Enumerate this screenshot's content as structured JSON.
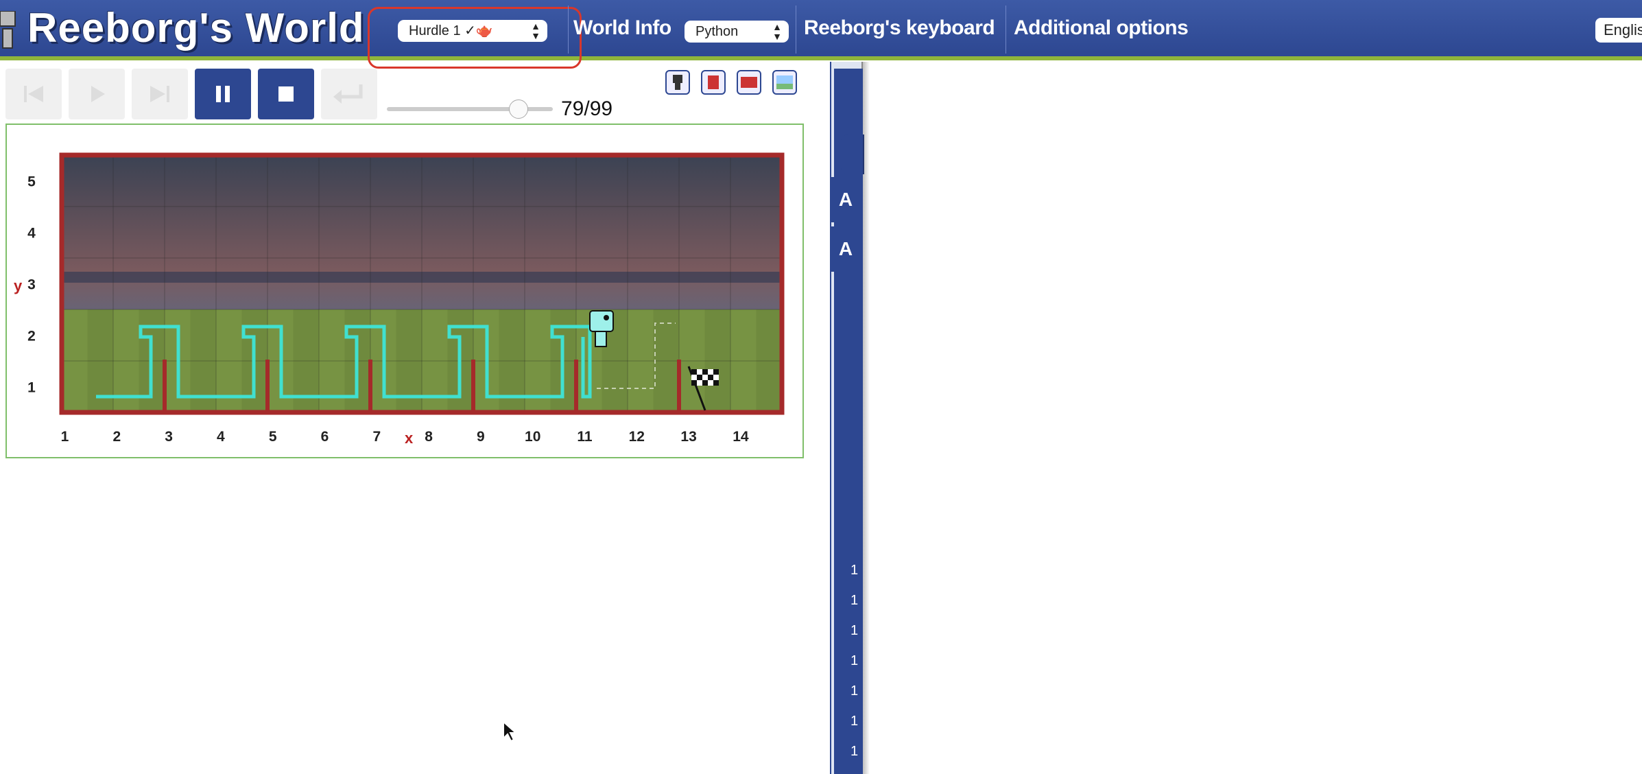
{
  "header": {
    "title": "Reeborg's World",
    "world_select": "Hurdle 1 ✓🫖",
    "world_info": "World Info",
    "language_select": "Python",
    "keyboard": "Reeborg's keyboard",
    "additional_options": "Additional options",
    "ui_language": "Englis"
  },
  "controls": {
    "step_counter": "79/99",
    "slider_fraction": 0.79,
    "buttons": [
      "first-step",
      "run",
      "step",
      "pause",
      "stop",
      "reload"
    ],
    "active_buttons": [
      "pause",
      "stop"
    ]
  },
  "world": {
    "y_label": "y",
    "x_label": "x",
    "x_ticks": [
      "1",
      "2",
      "3",
      "4",
      "5",
      "6",
      "7",
      "8",
      "9",
      "10",
      "11",
      "12",
      "13",
      "14"
    ],
    "y_ticks": [
      "1",
      "2",
      "3",
      "4",
      "5"
    ],
    "robot_position": [
      11,
      2
    ],
    "goal_position": [
      13,
      1
    ],
    "hurdles_after_x": [
      2,
      4,
      6,
      8,
      10,
      12
    ]
  },
  "editor": {
    "top_button": "A",
    "bottom_button": "A",
    "line_numbers": [
      "1",
      "1",
      "1",
      "1",
      "1",
      "1",
      "1"
    ]
  },
  "colors": {
    "nav": "#2d4791",
    "accent": "#8fb53b",
    "wall": "#a52a2a",
    "trace": "#40e0d0",
    "highlight": "#d9372b"
  }
}
